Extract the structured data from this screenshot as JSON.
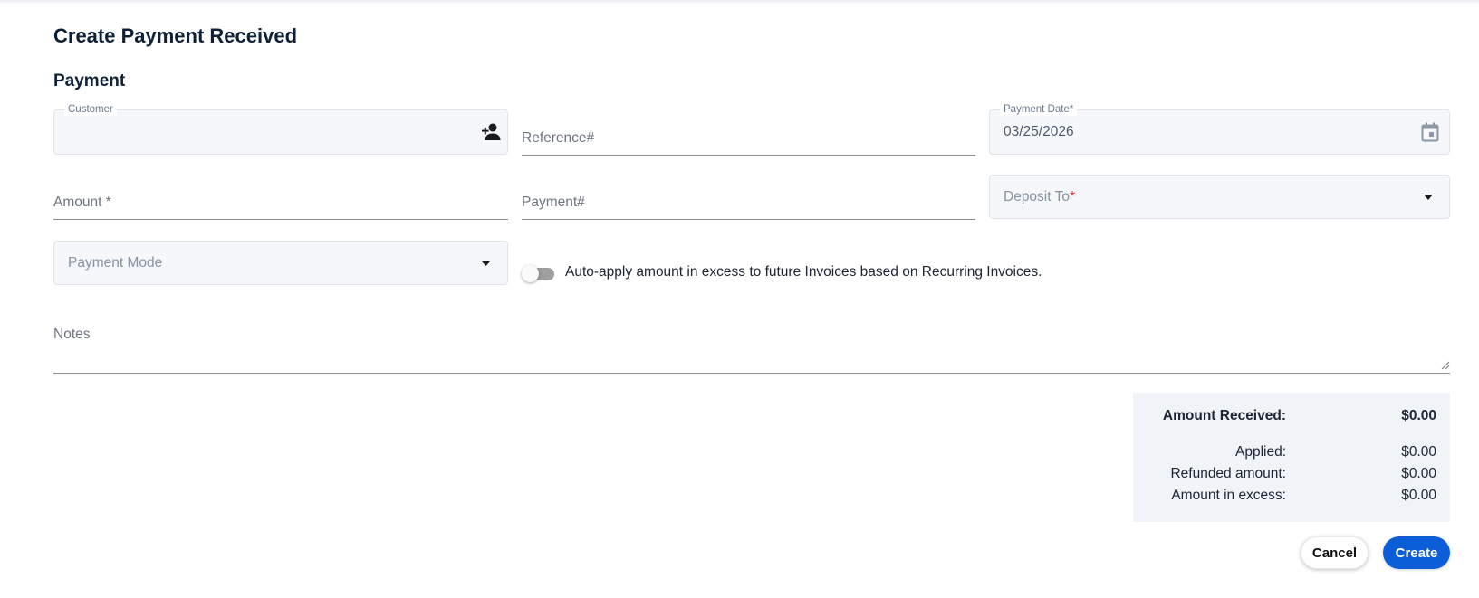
{
  "page": {
    "title": "Create Payment Received"
  },
  "section": {
    "title": "Payment"
  },
  "form": {
    "customer": {
      "label": "Customer",
      "value": ""
    },
    "reference": {
      "label": "Reference#"
    },
    "payment_date": {
      "label": "Payment Date*",
      "value": "03/25/2026"
    },
    "amount": {
      "label": "Amount *"
    },
    "payment_number": {
      "label": "Payment#"
    },
    "deposit_to": {
      "label": "Deposit To",
      "required_mark": "*"
    },
    "payment_mode": {
      "label": "Payment Mode"
    },
    "auto_apply": {
      "label": "Auto-apply amount in excess to future Invoices based on Recurring Invoices.",
      "enabled": false
    },
    "notes": {
      "label": "Notes"
    }
  },
  "summary": {
    "amount_received": {
      "label": "Amount Received:",
      "value": "$0.00"
    },
    "applied": {
      "label": "Applied:",
      "value": "$0.00"
    },
    "refunded": {
      "label": "Refunded amount:",
      "value": "$0.00"
    },
    "excess": {
      "label": "Amount in excess:",
      "value": "$0.00"
    }
  },
  "actions": {
    "cancel_label": "Cancel",
    "create_label": "Create"
  },
  "icons": {
    "customer_add": "person-add-icon",
    "payment_date": "calendar-icon",
    "deposit_to": "dropdown-arrow-icon",
    "payment_mode": "dropdown-arrow-icon"
  },
  "colors": {
    "primary": "#0b5ed7",
    "title": "#0f2138",
    "required": "#d32f2f",
    "summary_bg": "#f0f3f8"
  }
}
